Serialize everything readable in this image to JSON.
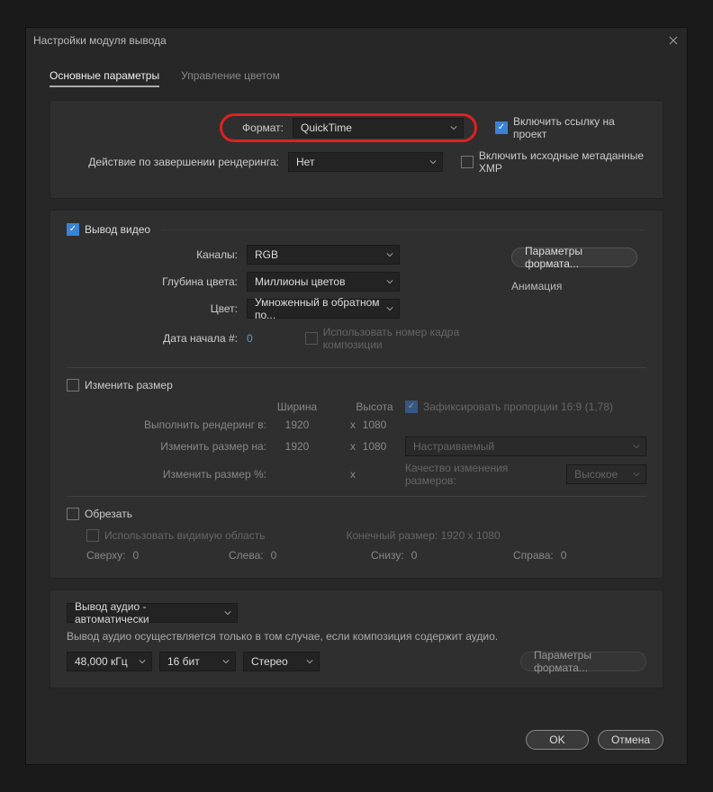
{
  "window": {
    "title": "Настройки модуля вывода"
  },
  "tabs": {
    "main": "Основные параметры",
    "color": "Управление цветом"
  },
  "top": {
    "format_label": "Формат:",
    "format_value": "QuickTime",
    "include_link_label": "Включить ссылку на проект",
    "post_render_label": "Действие по завершении рендеринга:",
    "post_render_value": "Нет",
    "include_xmp_label": "Включить исходные метаданные XMP"
  },
  "video": {
    "title": "Вывод видео",
    "channels_label": "Каналы:",
    "channels_value": "RGB",
    "depth_label": "Глубина цвета:",
    "depth_value": "Миллионы цветов",
    "color_label": "Цвет:",
    "color_value": "Умноженный в обратном по...",
    "start_label": "Дата начала #:",
    "start_value": "0",
    "use_comp_frame_label": "Использовать номер кадра композиции",
    "format_options_btn": "Параметры формата...",
    "animation_label": "Анимация"
  },
  "resize": {
    "title": "Изменить размер",
    "width_header": "Ширина",
    "height_header": "Высота",
    "lock_ratio_label": "Зафиксировать пропорции 16:9 (1,78)",
    "render_at_label": "Выполнить рендеринг в:",
    "render_w": "1920",
    "render_h": "1080",
    "resize_to_label": "Изменить размер на:",
    "resize_w": "1920",
    "resize_h": "1080",
    "preset_value": "Настраиваемый",
    "resize_pct_label": "Изменить размер %:",
    "quality_label": "Качество изменения размеров:",
    "quality_value": "Высокое",
    "x": "x"
  },
  "crop": {
    "title": "Обрезать",
    "use_roi_label": "Использовать видимую область",
    "final_size_label": "Конечный размер: 1920 x 1080",
    "top_label": "Сверху:",
    "top_val": "0",
    "left_label": "Слева:",
    "left_val": "0",
    "bottom_label": "Снизу:",
    "bottom_val": "0",
    "right_label": "Справа:",
    "right_val": "0"
  },
  "audio": {
    "mode_value": "Вывод аудио - автоматически",
    "note": "Вывод аудио осуществляется только в том случае, если композиция содержит аудио.",
    "rate_value": "48,000 кГц",
    "bits_value": "16 бит",
    "chan_value": "Стерео",
    "format_options_btn": "Параметры формата..."
  },
  "footer": {
    "ok": "OK",
    "cancel": "Отмена"
  }
}
